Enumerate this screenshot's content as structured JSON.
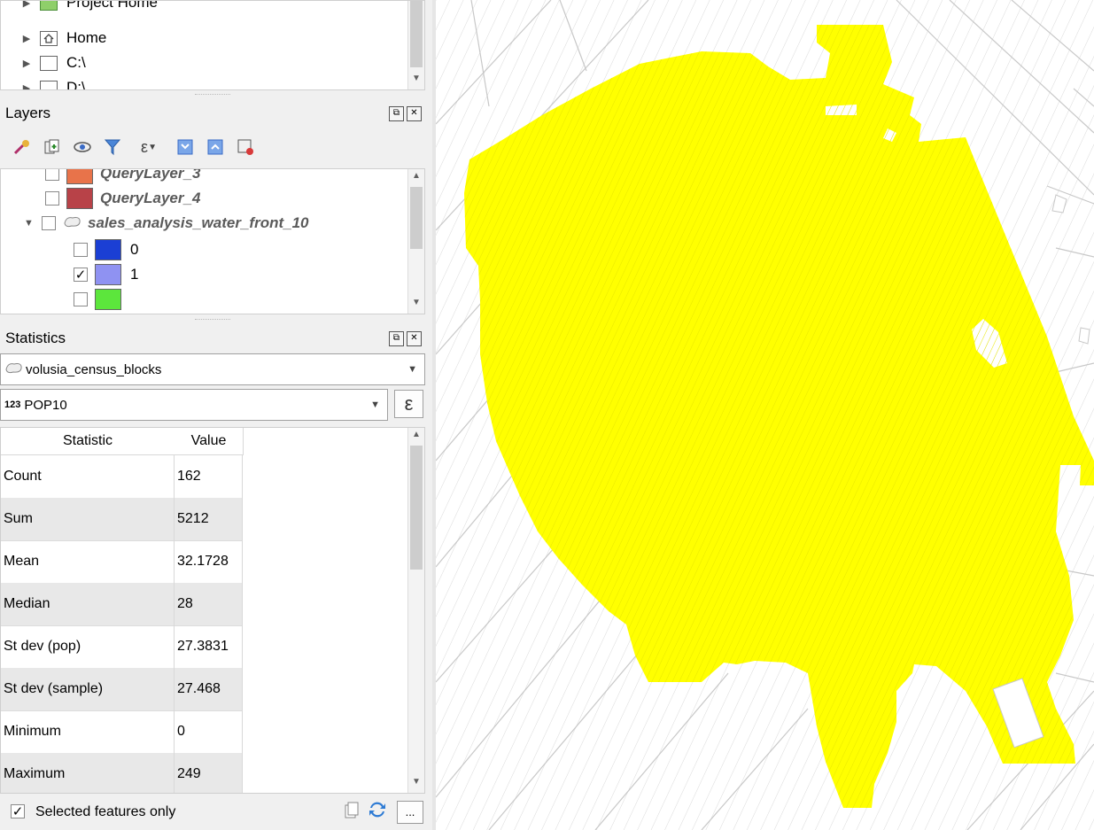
{
  "browser": {
    "items": [
      {
        "label": "Project Home",
        "icon": "project-home-icon"
      },
      {
        "label": "Home",
        "icon": "home-folder-icon"
      },
      {
        "label": "C:\\",
        "icon": "drive-icon"
      },
      {
        "label": "D:\\",
        "icon": "drive-icon"
      }
    ]
  },
  "layers_panel": {
    "title": "Layers",
    "toolbar_icons": [
      "style-manager-icon",
      "add-group-icon",
      "visibility-icon",
      "filter-icon",
      "expression-filter-icon",
      "expand-all-icon",
      "collapse-all-icon",
      "remove-layer-icon"
    ],
    "items": [
      {
        "label": "QueryLayer_3",
        "color": "#e8734a",
        "checked": false
      },
      {
        "label": "QueryLayer_4",
        "color": "#b84248",
        "checked": false
      },
      {
        "label": "sales_analysis_water_front_10",
        "checked": false,
        "expanded": true,
        "classes": [
          {
            "label": "0",
            "color": "#1b3fd4",
            "checked": false
          },
          {
            "label": "1",
            "color": "#8f92f2",
            "checked": true
          },
          {
            "label": "",
            "color": "#5ce63c",
            "checked": false
          }
        ]
      }
    ]
  },
  "statistics_panel": {
    "title": "Statistics",
    "layer_select": "volusia_census_blocks",
    "field_prefix": "123",
    "field_select": "POP10",
    "expression_button": "ε",
    "columns": [
      "Statistic",
      "Value"
    ],
    "rows": [
      {
        "stat": "Count",
        "value": "162"
      },
      {
        "stat": "Sum",
        "value": "5212"
      },
      {
        "stat": "Mean",
        "value": "32.1728"
      },
      {
        "stat": "Median",
        "value": "28"
      },
      {
        "stat": "St dev (pop)",
        "value": "27.3831"
      },
      {
        "stat": "St dev (sample)",
        "value": "27.468"
      },
      {
        "stat": "Minimum",
        "value": "0"
      },
      {
        "stat": "Maximum",
        "value": "249"
      }
    ],
    "selected_only_label": "Selected features only",
    "selected_only_checked": true,
    "more_button": "..."
  },
  "colors": {
    "selection_fill": "#ffff00",
    "map_background": "#ffffff",
    "parcel_lines": "#c8c8c8"
  }
}
